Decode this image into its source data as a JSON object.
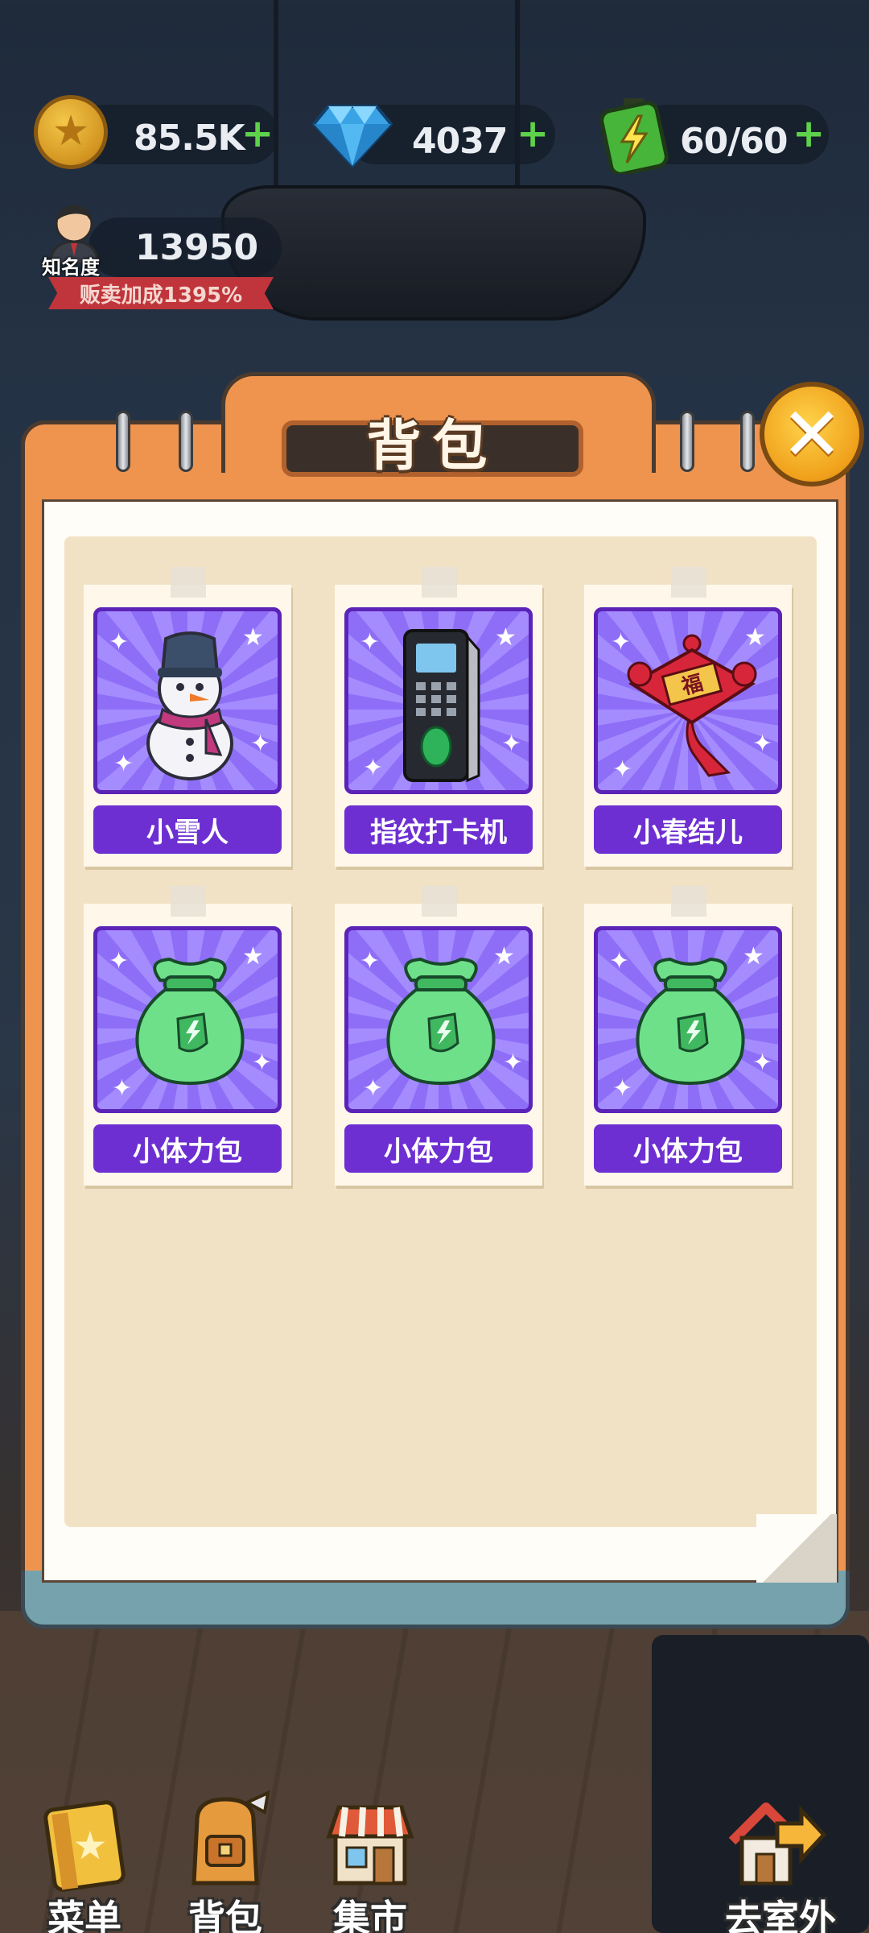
{
  "resources": {
    "coins": "85.5K",
    "gems": "4037",
    "energy": "60/60",
    "plus_symbol": "+"
  },
  "fame": {
    "label": "知名度",
    "value": "13950",
    "bonus": "贩卖加成1395%"
  },
  "panel": {
    "title": "背包",
    "close_symbol": "✕"
  },
  "items": [
    {
      "name": "小雪人",
      "icon": "snowman-icon"
    },
    {
      "name": "指纹打卡机",
      "icon": "fingerprint-scanner-icon"
    },
    {
      "name": "小春结儿",
      "icon": "chinese-knot-icon"
    },
    {
      "name": "小体力包",
      "icon": "energy-pack-icon"
    },
    {
      "name": "小体力包",
      "icon": "energy-pack-icon"
    },
    {
      "name": "小体力包",
      "icon": "energy-pack-icon"
    }
  ],
  "nav": {
    "menu": "菜单",
    "backpack": "背包",
    "market": "集市",
    "outdoor": "去室外"
  },
  "colors": {
    "panel_orange": "#ef944f",
    "card_purple": "#6d2fd2",
    "plus_green": "#5fd24b",
    "close_gold": "#f0a01b"
  }
}
